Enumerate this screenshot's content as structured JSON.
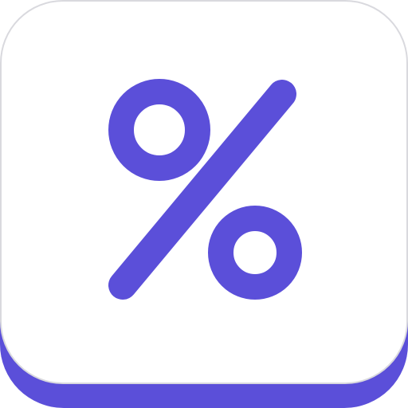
{
  "icon": {
    "name": "percent-icon",
    "glyph": "%",
    "colors": {
      "accent": "#5b4fd9",
      "face": "#ffffff",
      "edge": "#d9d9de",
      "background": "#ffffff"
    }
  }
}
